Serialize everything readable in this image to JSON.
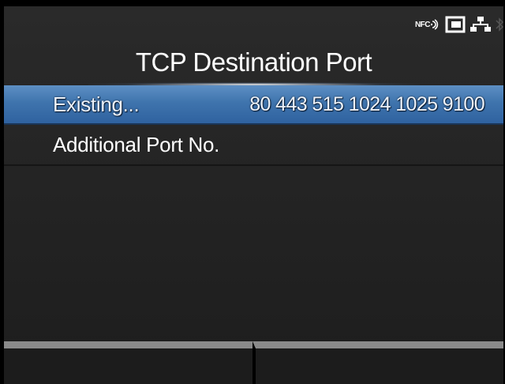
{
  "status": {
    "nfc_label": "NFC",
    "icons": [
      "nfc-icon",
      "storage-icon",
      "network-icon",
      "bluetooth-icon"
    ]
  },
  "header": {
    "title": "TCP Destination Port"
  },
  "list": {
    "items": [
      {
        "label": "Existing...",
        "value": "80 443 515 1024 1025 9100",
        "selected": true
      },
      {
        "label": "Additional Port No.",
        "value": "",
        "selected": false
      }
    ]
  },
  "softkeys": {
    "left_label": "",
    "right_label": ""
  },
  "colors": {
    "selection": "#3f74ad",
    "background": "#262626",
    "text": "#ffffff",
    "softkey_bar": "#8a8a8a"
  }
}
